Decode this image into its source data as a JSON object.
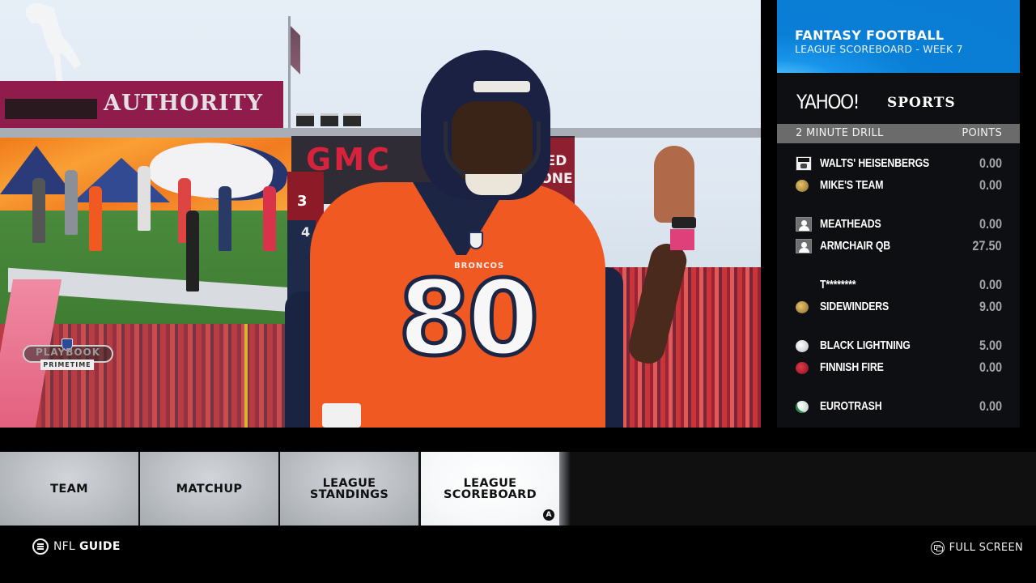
{
  "video": {
    "stadium_sign": "AUTHORITY",
    "board_brand": "GMC",
    "board_side_text": "ED\nONE",
    "score_home": "3",
    "score_away": "4",
    "jersey_number": "80",
    "jersey_team": "BRONCOS",
    "overlay_logo": {
      "main": "PLAYBOOK",
      "sub": "PRIMETIME"
    }
  },
  "panel": {
    "header_title": "FANTASY FOOTBALL",
    "header_subtitle": "LEAGUE SCOREBOARD - WEEK 7",
    "brand_word": "YAHOO!",
    "brand_sports": "SPORTS",
    "accent_color": "#0b7bd3",
    "column_left": "2 MINUTE DRILL",
    "column_right": "POINTS",
    "matchups": [
      {
        "teams": [
          {
            "name": "WALTS' HEISENBERGS",
            "points": "0.00",
            "icon": "heisenberg-avatar-icon"
          },
          {
            "name": "MIKE'S TEAM",
            "points": "0.00",
            "icon": "gold-helmet-icon"
          }
        ]
      },
      {
        "teams": [
          {
            "name": "MEATHEADS",
            "points": "0.00",
            "icon": "default-user-icon"
          },
          {
            "name": "ARMCHAIR QB",
            "points": "27.50",
            "icon": "default-user-icon"
          }
        ]
      },
      {
        "teams": [
          {
            "name": "T********",
            "points": "0.00",
            "icon": ""
          },
          {
            "name": "SIDEWINDERS",
            "points": "9.00",
            "icon": "gold-helmet-icon"
          }
        ]
      },
      {
        "teams": [
          {
            "name": "BLACK LIGHTNING",
            "points": "5.00",
            "icon": "white-helmet-icon"
          },
          {
            "name": "FINNISH FIRE",
            "points": "0.00",
            "icon": "red-helmet-icon"
          }
        ]
      },
      {
        "teams": [
          {
            "name": "EUROTRASH",
            "points": "0.00",
            "icon": "green-white-helmet-icon"
          }
        ]
      }
    ]
  },
  "tabs": [
    {
      "label": "TEAM",
      "active": false
    },
    {
      "label": "MATCHUP",
      "active": false
    },
    {
      "label": "LEAGUE\nSTANDINGS",
      "active": false
    },
    {
      "label": "LEAGUE\nSCOREBOARD",
      "active": true,
      "badge": "A"
    }
  ],
  "footer": {
    "nfl": "NFL",
    "guide": "GUIDE",
    "full_screen": "FULL SCREEN"
  }
}
